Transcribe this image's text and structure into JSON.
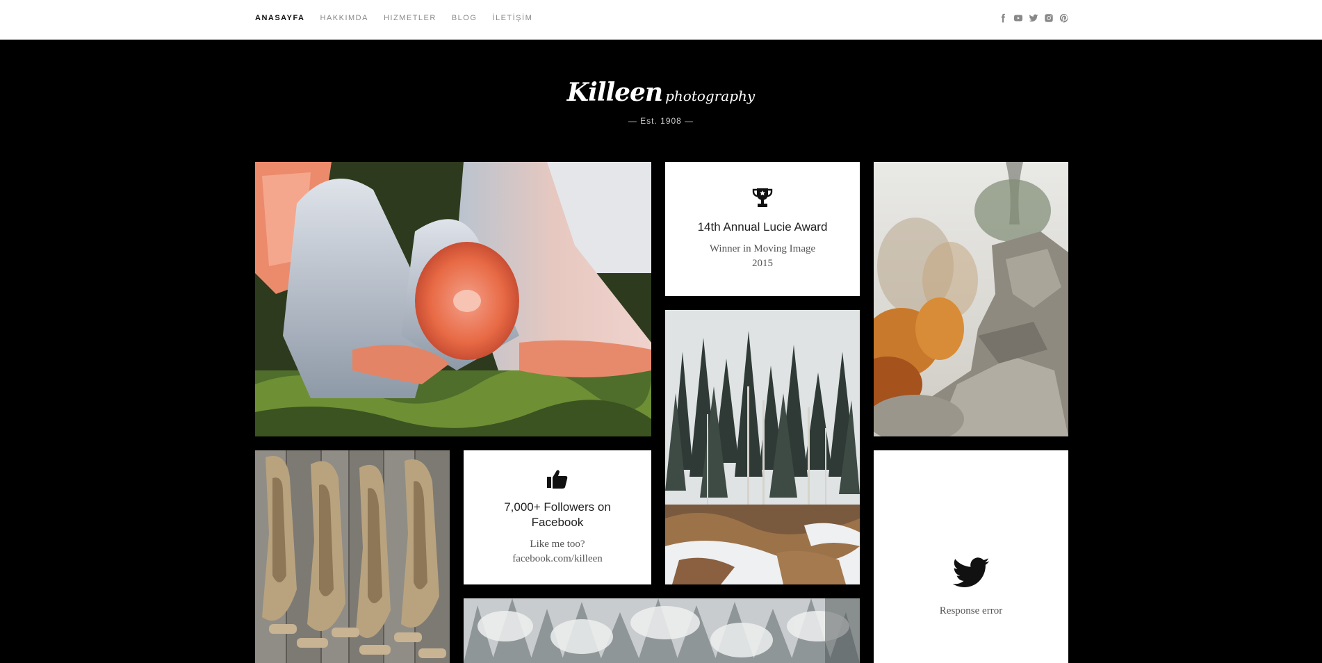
{
  "nav": {
    "items": [
      {
        "label": "ANASAYFA"
      },
      {
        "label": "HAKKIMDA"
      },
      {
        "label": "HIZMETLER"
      },
      {
        "label": "BLOG"
      },
      {
        "label": "İLETİŞİM"
      }
    ]
  },
  "social": {
    "icons": [
      "facebook-icon",
      "youtube-icon",
      "twitter-icon",
      "instagram-icon",
      "pinterest-icon"
    ]
  },
  "logo": {
    "script": "Killeen",
    "small": "photography",
    "est": "— Est. 1908 —"
  },
  "cards": {
    "award": {
      "icon": "trophy-icon",
      "title": "14th Annual Lucie Award",
      "line1": "Winner in Moving Image",
      "line2": "2015"
    },
    "facebook": {
      "icon": "thumbs-up-icon",
      "title_line1": "7,000+ Followers on",
      "title_line2": "Facebook",
      "line1": "Like me too?",
      "line2": "facebook.com/killeen"
    },
    "twitter": {
      "icon": "twitter-bird-icon",
      "text": "Response error"
    }
  },
  "colors": {
    "background": "#000000",
    "card": "#ffffff",
    "nav_active": "#111111",
    "nav_inactive": "#888888"
  }
}
